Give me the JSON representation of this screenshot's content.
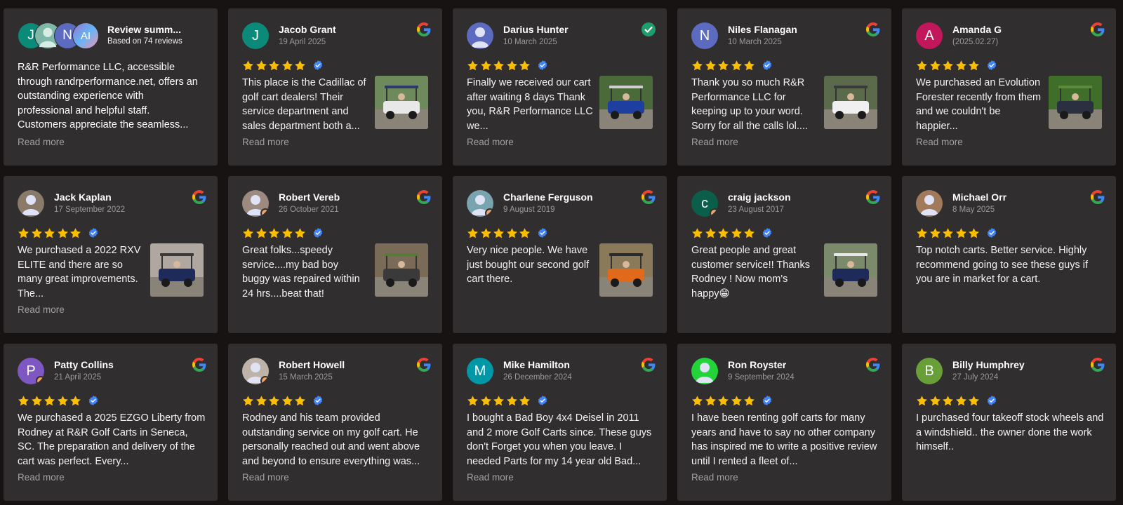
{
  "colors": {
    "background": "#161312",
    "card": "#302e2e",
    "star": "#fbbc04",
    "verified": "#4285f4",
    "muted": "#9d9a99"
  },
  "summary": {
    "title": "Review summ...",
    "subtitle": "Based on 74 reviews",
    "avatar_letters": [
      "J",
      "",
      "N",
      "AI"
    ],
    "text": "R&R Performance LLC, accessible through randrperformance.net, offers an outstanding experience with professional and helpful staff. Customers appreciate the seamless...",
    "read_more": "Read more"
  },
  "reviews": [
    {
      "name": "Jacob Grant",
      "date": "19 April 2025",
      "avatar_letter": "J",
      "avatar_color": "#0b8a7a",
      "icon": "google-icon",
      "rating": 5,
      "text": "This place is the Cadillac of golf cart dealers! Their service department and sales department both a...",
      "read_more": "Read more",
      "has_photo": true
    },
    {
      "name": "Darius Hunter",
      "date": "10 March 2025",
      "avatar_letter": "",
      "avatar_color": "#5c6bc0",
      "icon": "verified-check-icon",
      "rating": 5,
      "text": "Finally we received our cart after waiting 8 days Thank you, R&R Performance LLC we...",
      "read_more": "Read more",
      "has_photo": true
    },
    {
      "name": "Niles Flanagan",
      "date": "10 March 2025",
      "avatar_letter": "N",
      "avatar_color": "#5c6bc0",
      "icon": "google-icon",
      "rating": 5,
      "text": "Thank you so much R&R Performance LLC for keeping up to your word. Sorry for all the calls lol....",
      "read_more": "Read more",
      "has_photo": true
    },
    {
      "name": "Amanda G",
      "date": "(2025.02.27)",
      "avatar_letter": "A",
      "avatar_color": "#c2185b",
      "icon": "google-icon",
      "rating": 5,
      "text": "We purchased an Evolution Forester recently from them and we couldn't be happier...",
      "read_more": "Read more",
      "has_photo": true
    },
    {
      "name": "Jack Kaplan",
      "date": "17 September 2022",
      "avatar_letter": "",
      "avatar_color": "#8a7a6a",
      "icon": "google-icon",
      "rating": 5,
      "text": "We purchased a 2022 RXV ELITE and there are so many great improvements. The...",
      "read_more": "Read more",
      "has_photo": true
    },
    {
      "name": "Robert Vereb",
      "date": "26 October 2021",
      "avatar_letter": "",
      "avatar_color": "#9c8a80",
      "icon": "google-icon",
      "rating": 5,
      "text": "Great folks...speedy service....my bad boy buggy was repaired within 24 hrs....beat that!",
      "read_more": "",
      "has_photo": true
    },
    {
      "name": "Charlene Ferguson",
      "date": "9 August 2019",
      "avatar_letter": "",
      "avatar_color": "#7aa3b0",
      "icon": "google-icon",
      "rating": 5,
      "text": "Very nice people. We have just bought our second golf cart there.",
      "read_more": "",
      "has_photo": true
    },
    {
      "name": "craig jackson",
      "date": "23 August 2017",
      "avatar_letter": "c",
      "avatar_color": "#0b5e4a",
      "icon": "google-icon",
      "rating": 5,
      "text": "Great people and great customer service!! Thanks Rodney ! Now mom's happy😁",
      "read_more": "",
      "has_photo": true
    },
    {
      "name": "Michael Orr",
      "date": "8 May 2025",
      "avatar_letter": "",
      "avatar_color": "#a07a5a",
      "icon": "google-icon",
      "rating": 5,
      "text": "Top notch carts. Better service. Highly recommend going to see these guys if you are in market for a cart.",
      "read_more": "",
      "has_photo": false
    },
    {
      "name": "Patty Collins",
      "date": "21 April 2025",
      "avatar_letter": "P",
      "avatar_color": "#7e57c2",
      "icon": "google-icon",
      "rating": 5,
      "text": "We purchased a 2025 EZGO Liberty from Rodney at R&R Golf Carts in Seneca, SC. The preparation and delivery of the cart was perfect. Every...",
      "read_more": "Read more",
      "has_photo": false
    },
    {
      "name": "Robert Howell",
      "date": "15 March 2025",
      "avatar_letter": "",
      "avatar_color": "#bdb3a8",
      "icon": "google-icon",
      "rating": 5,
      "text": "Rodney and his team provided outstanding service on my golf cart. He personally reached out and went above and beyond to ensure everything was...",
      "read_more": "Read more",
      "has_photo": false
    },
    {
      "name": "Mike Hamilton",
      "date": "26 December 2024",
      "avatar_letter": "M",
      "avatar_color": "#0097a7",
      "icon": "google-icon",
      "rating": 5,
      "text": "I bought a Bad Boy 4x4 Deisel in 2011 and 2 more Golf Carts since. These guys don't Forget you when you leave. I needed Parts for my 14 year old Bad...",
      "read_more": "Read more",
      "has_photo": false
    },
    {
      "name": "Ron Royster",
      "date": "9 September 2024",
      "avatar_letter": "",
      "avatar_color": "#22d43a",
      "icon": "google-icon",
      "rating": 5,
      "text": "I have been renting golf carts for many years and have to say no other company has inspired me to write a positive review until I rented a fleet of...",
      "read_more": "Read more",
      "has_photo": false
    },
    {
      "name": "Billy Humphrey",
      "date": "27 July 2024",
      "avatar_letter": "B",
      "avatar_color": "#689f38",
      "icon": "google-icon",
      "rating": 5,
      "text": "I purchased four takeoff stock wheels and a windshield.. the owner done the work himself..",
      "read_more": "",
      "has_photo": false
    }
  ]
}
